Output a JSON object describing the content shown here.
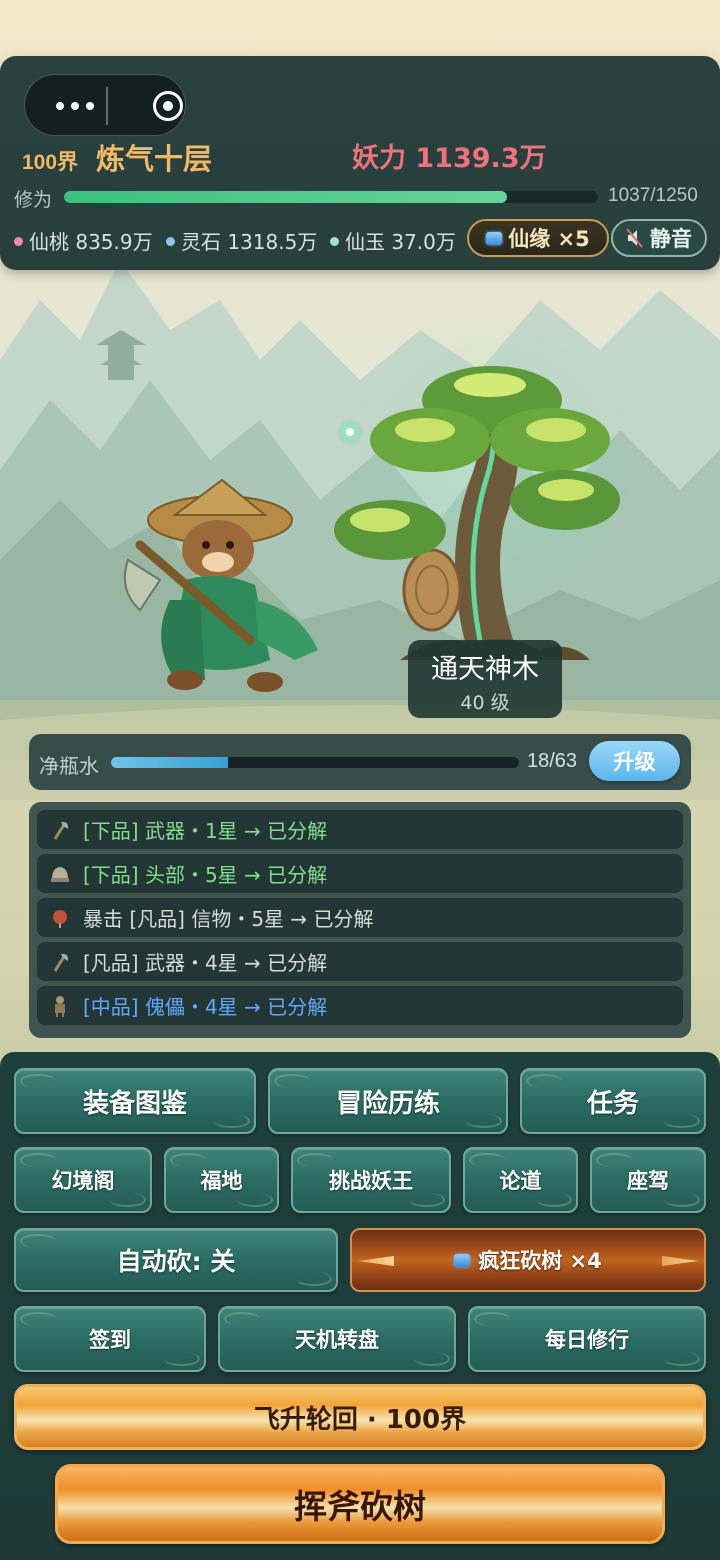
{
  "header": {
    "realm_tag": "100界",
    "realm_name": "炼气十层",
    "power": "妖力 1139.3万",
    "xiuwei_label": "修为",
    "xiuwei_value": "1037/1250",
    "xiuwei_progress": 0.8296
  },
  "resources": [
    {
      "label": "仙桃 835.9万"
    },
    {
      "label": "灵石 1318.5万"
    },
    {
      "label": "仙玉 37.0万"
    }
  ],
  "xianyuan_button": "仙缘 ×5",
  "mute_button": "静音",
  "tree": {
    "name": "通天神木",
    "level": "40 级"
  },
  "water": {
    "label": "净瓶水",
    "value": "18/63",
    "progress": 0.2857,
    "upgrade_label": "升级"
  },
  "log": [
    {
      "text": "[下品] 武器・1星 → 已分解",
      "color": "green",
      "icon": "axe-icon"
    },
    {
      "text": "[下品] 头部・5星 → 已分解",
      "color": "green",
      "icon": "helmet-icon"
    },
    {
      "text": "暴击 [凡品] 信物・5星 → 已分解",
      "color": "gray",
      "icon": "token-icon"
    },
    {
      "text": "[凡品] 武器・4星 → 已分解",
      "color": "gray",
      "icon": "axe-icon"
    },
    {
      "text": "[中品] 傀儡・4星 → 已分解",
      "color": "blue",
      "icon": "puppet-icon"
    }
  ],
  "menu": {
    "row1": [
      "装备图鉴",
      "冒险历练",
      "任务"
    ],
    "row2": [
      "幻境阁",
      "福地",
      "挑战妖王",
      "论道",
      "座驾"
    ],
    "auto_chop": "自动砍: 关",
    "crazy_chop": "疯狂砍树 ×4",
    "row4": [
      "签到",
      "天机转盘",
      "每日修行"
    ],
    "ascend": "飞升轮回 · 100界",
    "chop": "挥斧砍树"
  },
  "colors": {
    "accent_gold": "#f1b866",
    "power_red": "#f1707a",
    "xiuwei_green": "#4fc98a",
    "water_blue": "#5bb6ec",
    "log_green": "#7ee08a",
    "log_blue": "#5fa8ff"
  }
}
